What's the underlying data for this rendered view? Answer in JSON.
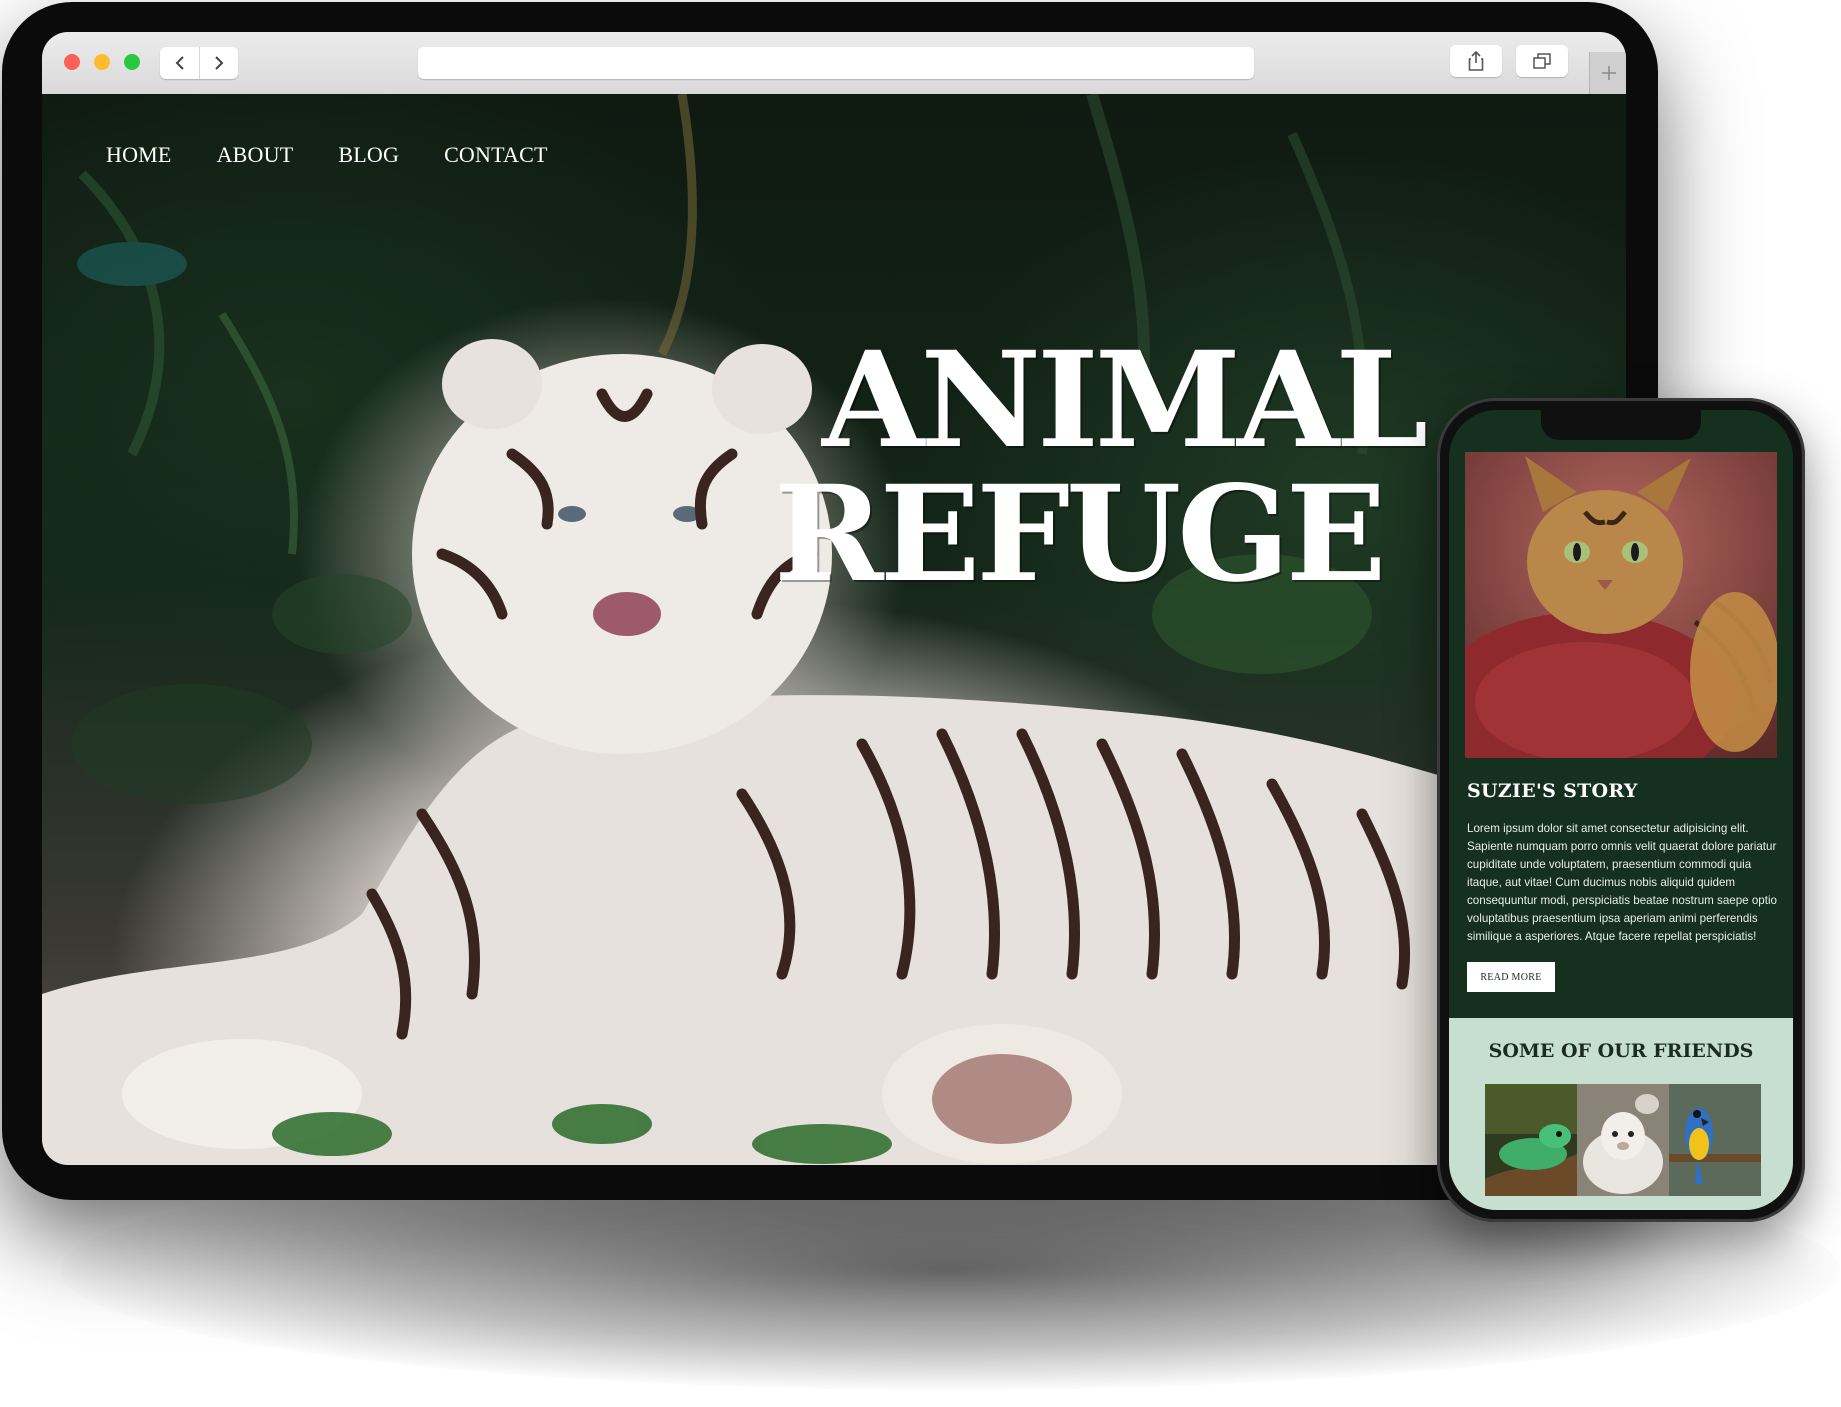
{
  "desktop": {
    "nav": [
      "HOME",
      "ABOUT",
      "BLOG",
      "CONTACT"
    ],
    "hero_title_line1": "ANIMAL",
    "hero_title_line2": "REFUGE"
  },
  "mobile": {
    "story_title": "SUZIE'S STORY",
    "story_body": "Lorem ipsum dolor sit amet consectetur adipisicing elit. Sapiente numquam porro omnis velit quaerat dolore pariatur cupiditate unde voluptatem, praesentium commodi quia itaque, aut vitae! Cum ducimus nobis aliquid quidem consequuntur modi, perspiciatis beatae nostrum saepe optio voluptatibus praesentium ipsa aperiam animi perferendis similique a asperiores. Atque facere repellat perspiciatis!",
    "read_more": "READ MORE",
    "friends_title": "SOME OF OUR FRIENDS",
    "friends": [
      "lizard",
      "sheep",
      "parrot"
    ]
  },
  "colors": {
    "mobile_bg": "#16301f",
    "friends_bg": "#c7dfd1",
    "traffic_red": "#fe5f57",
    "traffic_yellow": "#febc2e",
    "traffic_green": "#28c840"
  }
}
